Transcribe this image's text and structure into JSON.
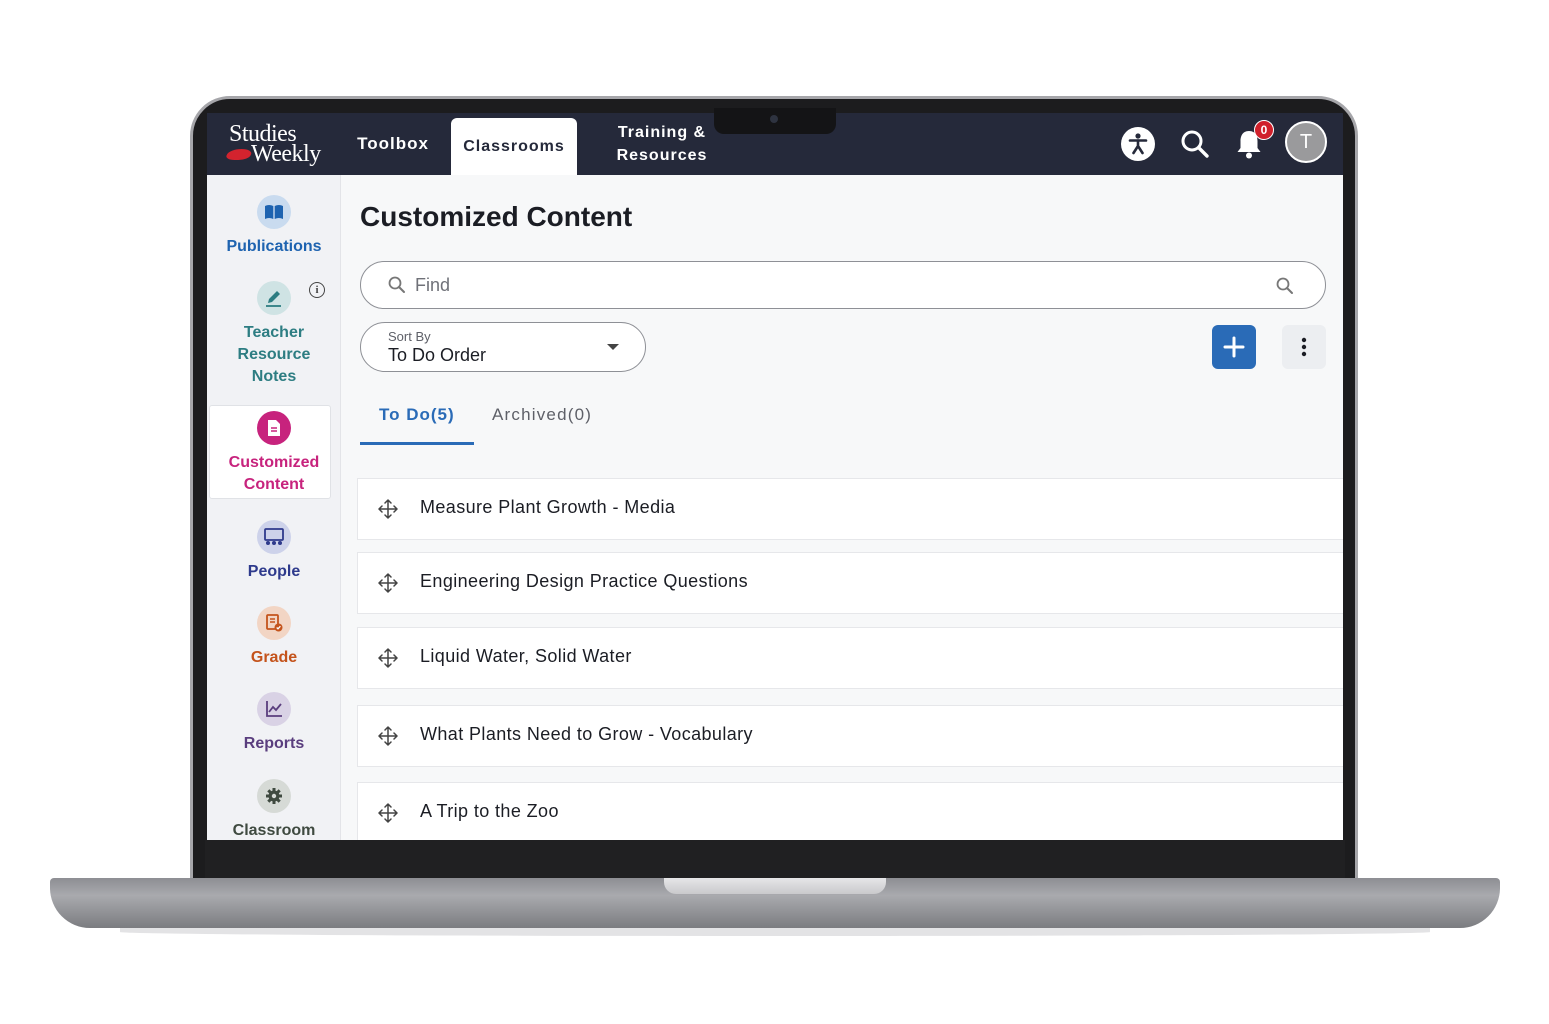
{
  "nav": {
    "logo_line1": "Studies",
    "logo_line2": "Weekly",
    "items": [
      {
        "label": "Toolbox"
      },
      {
        "label": "Classrooms",
        "active": true
      },
      {
        "label": "Training &\nResources"
      }
    ],
    "notification_count": "0",
    "avatar_initial": "T",
    "icons": [
      "accessibility-icon",
      "search-icon",
      "bell-icon"
    ]
  },
  "sidebar": {
    "items": [
      {
        "label": "Publications",
        "icon": "book-icon",
        "color": "#1e63b0",
        "bg": "#c9dbef"
      },
      {
        "label": "Teacher\nResource\nNotes",
        "icon": "pen-icon",
        "color": "#2d7d82",
        "bg": "#cfe3e4"
      },
      {
        "label": "Customized\nContent",
        "icon": "document-icon",
        "color": "#c7237d",
        "bg": "#c7237d",
        "active": true
      },
      {
        "label": "People",
        "icon": "people-icon",
        "color": "#2e3a8c",
        "bg": "#cdd2ea"
      },
      {
        "label": "Grade",
        "icon": "grade-icon",
        "color": "#c4531b",
        "bg": "#f2d5c4"
      },
      {
        "label": "Reports",
        "icon": "chart-icon",
        "color": "#5a3e7e",
        "bg": "#d9d2e5"
      },
      {
        "label": "Classroom",
        "icon": "gear-icon",
        "color": "#3f4a40",
        "bg": "#d6dad6"
      }
    ]
  },
  "main": {
    "title": "Customized Content",
    "search": {
      "placeholder": "Find",
      "value": ""
    },
    "sort": {
      "label": "Sort By",
      "value": "To Do Order"
    },
    "tabs": [
      {
        "label": "To Do(5)",
        "active": true
      },
      {
        "label": "Archived(0)",
        "active": false
      }
    ],
    "items": [
      {
        "title": "Measure Plant Growth - Media"
      },
      {
        "title": "Engineering Design Practice Questions"
      },
      {
        "title": "Liquid Water, Solid Water"
      },
      {
        "title": "What Plants Need to Grow - Vocabulary"
      },
      {
        "title": "A Trip to the Zoo"
      }
    ]
  },
  "colors": {
    "header_bg": "#25293a",
    "accent_blue": "#2a6bb7",
    "accent_pink": "#c7237d",
    "badge_red": "#d0202b"
  }
}
